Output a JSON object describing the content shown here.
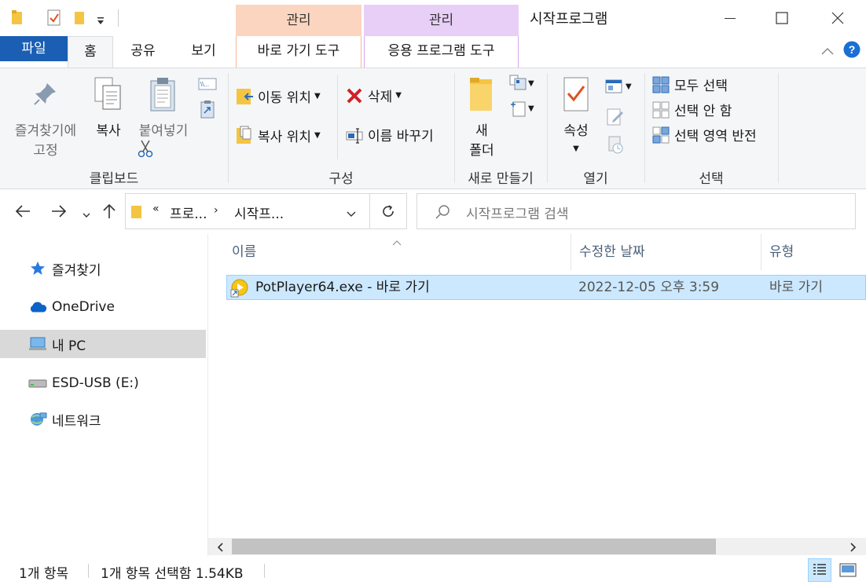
{
  "titlebar": {
    "title": "시작프로그램",
    "context_tab_shortcut": "관리",
    "context_tab_app": "관리"
  },
  "ribbon_tabs": {
    "file": "파일",
    "home": "홈",
    "share": "공유",
    "view": "보기",
    "shortcut_tools": "바로 가기 도구",
    "app_tools": "응용 프로그램 도구"
  },
  "ribbon": {
    "clipboard": {
      "pin_line1": "즐겨찾기에",
      "pin_line2": "고정",
      "copy": "복사",
      "paste": "붙여넣기",
      "label": "클립보드"
    },
    "organize": {
      "move_to": "이동 위치",
      "copy_to": "복사 위치",
      "delete": "삭제",
      "rename": "이름 바꾸기",
      "label": "구성"
    },
    "new": {
      "folder_line1": "새",
      "folder_line2": "폴더",
      "label": "새로 만들기"
    },
    "open": {
      "properties": "속성",
      "label": "열기"
    },
    "select": {
      "select_all": "모두 선택",
      "select_none": "선택 안 함",
      "invert": "선택 영역 반전",
      "label": "선택"
    }
  },
  "address": {
    "crumb_overflow": "«",
    "crumb1": "프로...",
    "crumb2": "시작프...",
    "search_placeholder": "시작프로그램 검색"
  },
  "nav": {
    "items": [
      {
        "label": "즐겨찾기",
        "icon": "star-icon"
      },
      {
        "label": "OneDrive",
        "icon": "cloud-icon"
      },
      {
        "label": "내 PC",
        "icon": "computer-icon",
        "selected": true
      },
      {
        "label": "ESD-USB (E:)",
        "icon": "drive-icon"
      },
      {
        "label": "네트워크",
        "icon": "network-icon"
      }
    ]
  },
  "columns": {
    "name": "이름",
    "modified": "수정한 날짜",
    "type": "유형"
  },
  "files": [
    {
      "name": "PotPlayer64.exe - 바로 가기",
      "modified": "2022-12-05 오후 3:59",
      "type": "바로 가기",
      "selected": true
    }
  ],
  "status": {
    "count": "1개 항목",
    "selection": "1개 항목 선택함 1.54KB"
  },
  "colors": {
    "file_tab": "#1a5fb4",
    "selection": "#cce8ff",
    "context_shortcut": "#fbd5c0",
    "context_app": "#e8cff7"
  }
}
